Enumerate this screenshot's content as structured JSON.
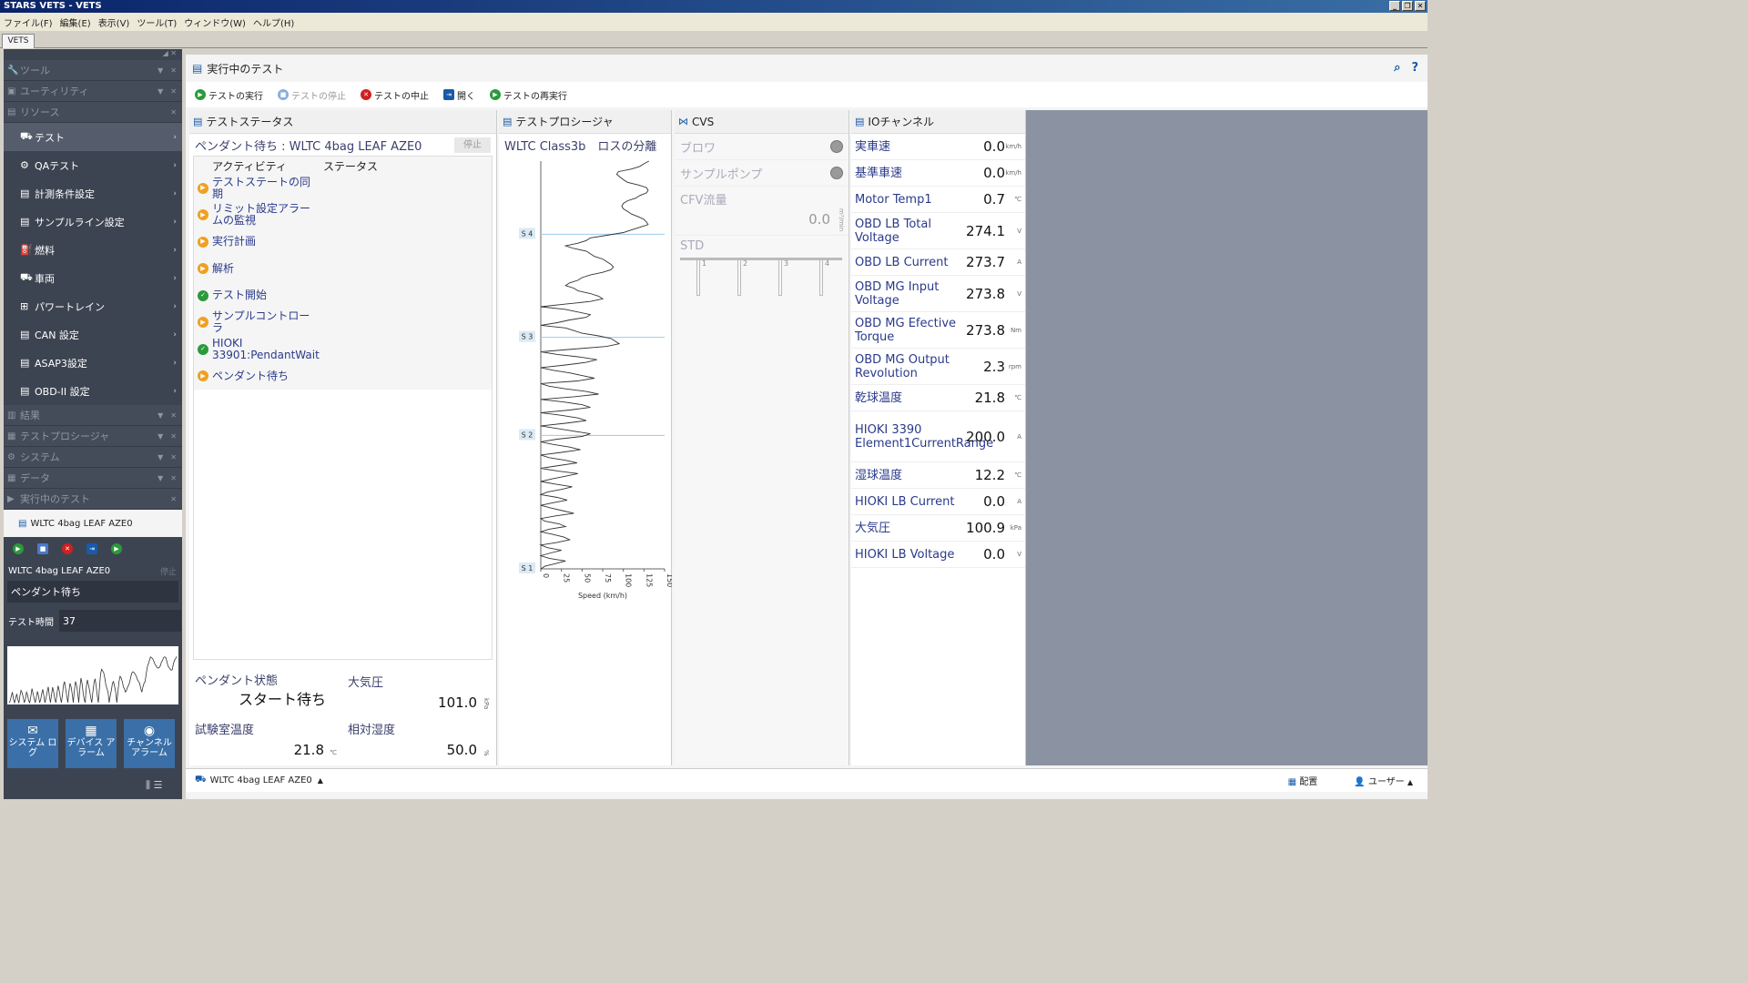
{
  "window": {
    "title": "STARS VETS - VETS"
  },
  "menu": [
    "ファイル(F)",
    "編集(E)",
    "表示(V)",
    "ツール(T)",
    "ウィンドウ(W)",
    "ヘルプ(H)"
  ],
  "doc_tab": "VETS",
  "sidebar": {
    "sections_top": [
      "ツール",
      "ユーティリティ",
      "リソース"
    ],
    "resources": [
      "テスト",
      "QAテスト",
      "計測条件設定",
      "サンプルライン設定",
      "燃料",
      "車両",
      "パワートレイン",
      "CAN 設定",
      "ASAP3設定",
      "OBD-II 設定"
    ],
    "sections_bottom": [
      "結果",
      "テストプロシージャ",
      "システム",
      "データ",
      "実行中のテスト"
    ],
    "running_item": "WLTC 4bag LEAF AZE0",
    "run_name": "WLTC 4bag LEAF AZE0",
    "run_stop": "停止",
    "state": "ペンダント待ち",
    "time_label": "テスト時間",
    "time_value": "37",
    "buttons": [
      "システム ログ",
      "デバイス アラーム",
      "チャンネル アラーム"
    ]
  },
  "main": {
    "title": "実行中のテスト",
    "toolbar": [
      "テストの実行",
      "テストの停止",
      "テストの中止",
      "開く",
      "テストの再実行"
    ]
  },
  "status_panel": {
    "title": "テストステータス",
    "pendant": "ペンダント待ち : WLTC 4bag LEAF AZE0",
    "stop": "停止",
    "col_activity": "アクティビティ",
    "col_status": "ステータス",
    "activities": [
      {
        "label": "テストステートの同期",
        "state": "pending"
      },
      {
        "label": "リミット設定アラームの監視",
        "state": "pending"
      },
      {
        "label": "実行計画",
        "state": "pending"
      },
      {
        "label": "解析",
        "state": "pending"
      },
      {
        "label": "テスト開始",
        "state": "done"
      },
      {
        "label": "サンプルコントローラ",
        "state": "pending"
      },
      {
        "label": "HIOKI 33901:PendantWait",
        "state": "done"
      },
      {
        "label": "ペンダント待ち",
        "state": "pending"
      }
    ],
    "pendant_state_label": "ペンダント状態",
    "pendant_state_value": "スタート待ち",
    "atm_label": "大気圧",
    "atm_value": "101.0",
    "atm_unit": "kPa",
    "room_temp_label": "試験室温度",
    "room_temp_value": "21.8",
    "room_temp_unit": "℃",
    "humidity_label": "相対湿度",
    "humidity_value": "50.0",
    "humidity_unit": "%"
  },
  "procedure_panel": {
    "title": "テストプロシージャ",
    "subtitle": "WLTC Class3b　ロスの分離"
  },
  "chart_data": {
    "type": "line",
    "xlabel": "Speed (km/h)",
    "xlim": [
      0,
      150
    ],
    "xticks": [
      "0",
      "25",
      "50",
      "75",
      "100",
      "125",
      "150"
    ],
    "phases": [
      "S 1",
      "S 2",
      "S 3",
      "S 4"
    ],
    "phase_bounds": [
      0,
      589,
      1022,
      1477,
      1800
    ],
    "series": [
      {
        "values": [
          0,
          5,
          18,
          30,
          10,
          0,
          12,
          25,
          8,
          0,
          20,
          35,
          28,
          15,
          0,
          10,
          30,
          22,
          5,
          0,
          18,
          40,
          26,
          12,
          0,
          15,
          32,
          20,
          0,
          8,
          25,
          38,
          18,
          0,
          14,
          30,
          45,
          20,
          0,
          22,
          44,
          30,
          10,
          0,
          25,
          48,
          35,
          15,
          0,
          20,
          50,
          60,
          40,
          20,
          0,
          30,
          55,
          45,
          25,
          0,
          35,
          60,
          50,
          28,
          0,
          40,
          70,
          55,
          30,
          10,
          0,
          45,
          65,
          50,
          35,
          15,
          0,
          30,
          55,
          68,
          48,
          20,
          0,
          40,
          80,
          95,
          90,
          85,
          70,
          50,
          40,
          30,
          0,
          20,
          35,
          55,
          60,
          45,
          30,
          0,
          30,
          60,
          75,
          70,
          60,
          45,
          40,
          30,
          35,
          45,
          50,
          60,
          75,
          85,
          88,
          85,
          80,
          75,
          65,
          60,
          55,
          40,
          30,
          45,
          55,
          60,
          80,
          100,
          110,
          120,
          130,
          128,
          125,
          118,
          110,
          105,
          100,
          98,
          100,
          105,
          115,
          120,
          128,
          130,
          128,
          118,
          105,
          100,
          96,
          92,
          94,
          110,
          120,
          125,
          131
        ]
      }
    ]
  },
  "cvs_panel": {
    "title": "CVS",
    "blower": "ブロワ",
    "pump": "サンプルポンプ",
    "cfv_label": "CFV流量",
    "cfv_value": "0.0",
    "cfv_unit": "m³/min",
    "std_label": "STD",
    "std_ticks": [
      "1",
      "2",
      "3",
      "4"
    ]
  },
  "io_panel": {
    "title": "IOチャンネル",
    "rows": [
      {
        "name": "実車速",
        "value": "0.0",
        "unit": "km/h"
      },
      {
        "name": "基準車速",
        "value": "0.0",
        "unit": "km/h"
      },
      {
        "name": "Motor Temp1",
        "value": "0.7",
        "unit": "℃"
      },
      {
        "name": "OBD LB Total Voltage",
        "value": "274.1",
        "unit": "V"
      },
      {
        "name": "OBD LB Current",
        "value": "273.7",
        "unit": "A"
      },
      {
        "name": "OBD MG Input Voltage",
        "value": "273.8",
        "unit": "V"
      },
      {
        "name": "OBD MG Efective Torque",
        "value": "273.8",
        "unit": "Nm"
      },
      {
        "name": "OBD MG Output Revolution",
        "value": "2.3",
        "unit": "rpm"
      },
      {
        "name": "乾球温度",
        "value": "21.8",
        "unit": "℃"
      },
      {
        "name": "HIOKI 3390 Element1CurrentRange",
        "value": "200.0",
        "unit": "A"
      },
      {
        "name": "湿球温度",
        "value": "12.2",
        "unit": "℃"
      },
      {
        "name": "HIOKI LB Current",
        "value": "0.0",
        "unit": "A"
      },
      {
        "name": "大気圧",
        "value": "100.9",
        "unit": "kPa"
      },
      {
        "name": "HIOKI LB Voltage",
        "value": "0.0",
        "unit": "V"
      }
    ]
  },
  "statusbar": {
    "test": "WLTC 4bag LEAF AZE0",
    "layout": "配置",
    "user": "ユーザー"
  },
  "colors": {
    "sidebar_bg": "#3d4451",
    "accent_blue": "#1a5aa8",
    "pending": "#f0a020",
    "done": "#2a9a3a",
    "abort": "#d02020"
  }
}
